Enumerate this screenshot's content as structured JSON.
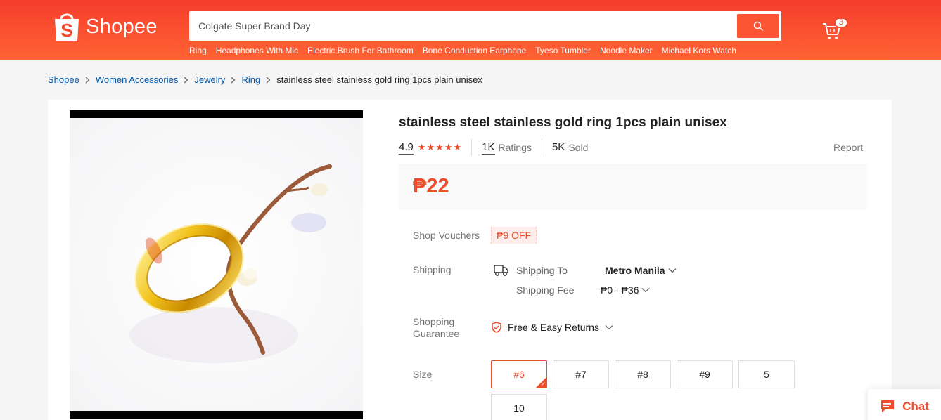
{
  "header": {
    "brand": "Shopee",
    "search_placeholder": "Colgate Super Brand Day",
    "cart_count": "3",
    "suggestions": [
      "Ring",
      "Headphones With Mic",
      "Electric Brush For Bathroom",
      "Bone Conduction Earphone",
      "Tyeso Tumbler",
      "Noodle Maker",
      "Michael Kors Watch"
    ]
  },
  "breadcrumb": {
    "items": [
      "Shopee",
      "Women Accessories",
      "Jewelry",
      "Ring"
    ],
    "current": "stainless steel stainless gold ring 1pcs plain unisex"
  },
  "product": {
    "title": "stainless steel stainless gold ring 1pcs plain unisex",
    "rating": "4.9",
    "ratings_count": "1K",
    "ratings_label": "Ratings",
    "sold_count": "5K",
    "sold_label": "Sold",
    "report_label": "Report",
    "price": "₱22",
    "vouchers_label": "Shop Vouchers",
    "voucher": "₱9 OFF",
    "shipping_label": "Shipping",
    "shipping_to_label": "Shipping To",
    "shipping_to_value": "Metro Manila",
    "shipping_fee_label": "Shipping Fee",
    "shipping_fee_value": "₱0 - ₱36",
    "guarantee_label_line1": "Shopping",
    "guarantee_label_line2": "Guarantee",
    "guarantee_value": "Free & Easy Returns",
    "size_label": "Size",
    "sizes": [
      "#6",
      "#7",
      "#8",
      "#9",
      "5",
      "10"
    ],
    "selected_size": "#6"
  },
  "chat": {
    "label": "Chat"
  },
  "colors": {
    "brand": "#ee4d2d",
    "header_start": "#f53d2d",
    "header_end": "#ff6433",
    "link": "#0055aa"
  }
}
